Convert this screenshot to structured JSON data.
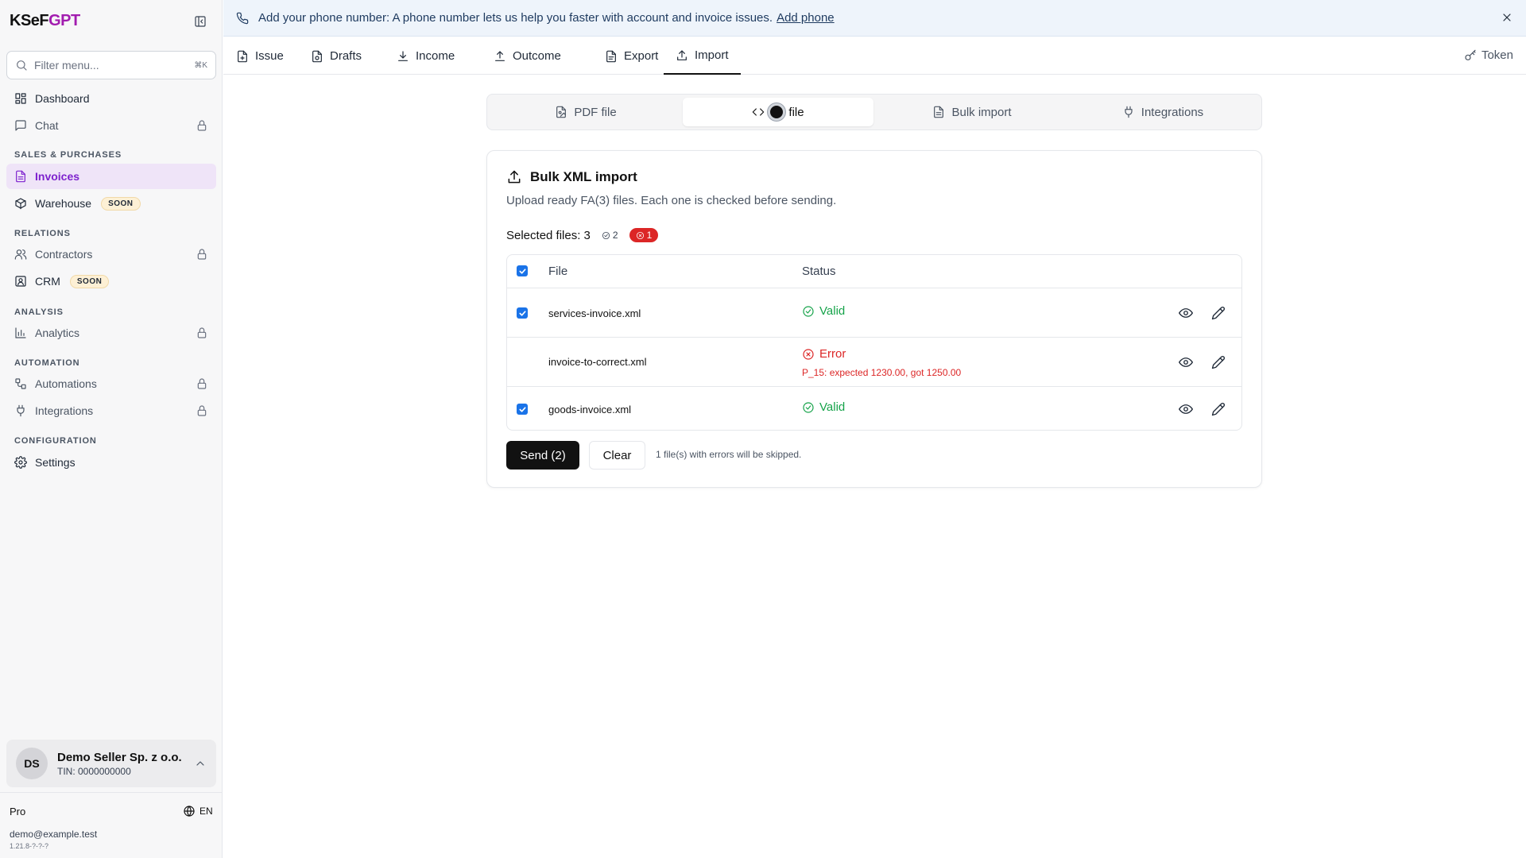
{
  "app": {
    "logo_main": "KSeF",
    "logo_accent": "GPT"
  },
  "sidebar": {
    "filter_placeholder": "Filter menu...",
    "filter_shortcut": "⌘K",
    "items": {
      "dashboard": "Dashboard",
      "chat": "Chat",
      "invoices": "Invoices",
      "warehouse": "Warehouse",
      "contractors": "Contractors",
      "crm": "CRM",
      "analytics": "Analytics",
      "automations": "Automations",
      "integrations": "Integrations",
      "settings": "Settings"
    },
    "sections": {
      "sales": "SALES & PURCHASES",
      "relations": "RELATIONS",
      "analysis": "ANALYSIS",
      "automation": "AUTOMATION",
      "configuration": "CONFIGURATION"
    },
    "soon_badge": "SOON",
    "account": {
      "initials": "DS",
      "name": "Demo Seller Sp. z o.o.",
      "tin": "TIN: 0000000000"
    },
    "plan": "Pro",
    "language": "EN",
    "email": "demo@example.test",
    "version": "1.21.8-?-?-?"
  },
  "banner": {
    "text": "Add your phone number: A phone number lets us help you faster with account and invoice issues.",
    "link": "Add phone"
  },
  "top_tabs": {
    "issue": "Issue",
    "drafts": "Drafts",
    "income": "Income",
    "outcome": "Outcome",
    "export": "Export",
    "import": "Import",
    "token": "Token"
  },
  "import_tabs": {
    "pdf": "PDF file",
    "xml": "file",
    "bulk": "Bulk import",
    "integrations": "Integrations"
  },
  "card": {
    "title": "Bulk XML import",
    "description": "Upload ready FA(3) files. Each one is checked before sending.",
    "selected_label": "Selected files: 3",
    "valid_count": "2",
    "error_count": "1",
    "columns": {
      "file": "File",
      "status": "Status"
    },
    "rows": [
      {
        "file": "services-invoice.xml",
        "status": "Valid",
        "checked": true
      },
      {
        "file": "invoice-to-correct.xml",
        "status": "Error",
        "detail": "P_15: expected 1230.00, got 1250.00",
        "checked": false
      },
      {
        "file": "goods-invoice.xml",
        "status": "Valid",
        "checked": true
      }
    ],
    "send_label": "Send (2)",
    "clear_label": "Clear",
    "skip_note": "1 file(s) with errors will be skipped."
  },
  "colors": {
    "accent": "#7e22ce",
    "valid": "#16a34a",
    "error": "#dc2626",
    "primary_button": "#111111"
  }
}
